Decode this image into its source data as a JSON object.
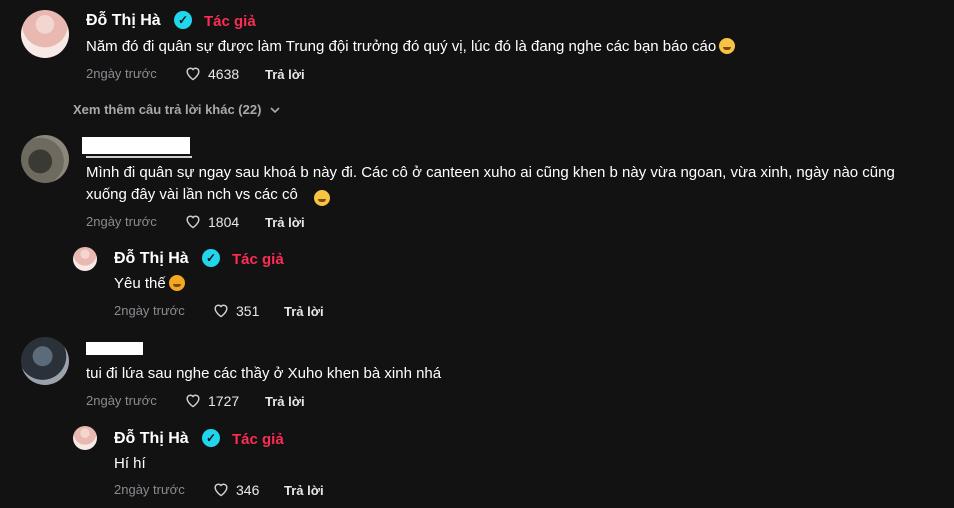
{
  "author": {
    "name": "Đỗ Thị Hà",
    "tag": "Tác giả",
    "verified_icon": "verified-check-icon",
    "badge_color": "#20d5ec",
    "tag_color": "#fe2c55"
  },
  "comments": [
    {
      "text": "Năm đó đi quân sự được làm Trung đội trưởng đó quý vị, lúc đó là đang nghe các bạn báo cáo",
      "time": "2ngày trước",
      "likes": "4638",
      "reply_label": "Trả lời",
      "more_replies": "Xem thêm câu trả lời khác (22)"
    },
    {
      "text": "Mình đi quân sự ngay sau khoá b này đi. Các cô ở canteen xuho ai cũng khen b này vừa ngoan, vừa xinh, ngày nào cũng xuống đây vài lần nch vs các cô",
      "time": "2ngày trước",
      "likes": "1804",
      "reply_label": "Trả lời",
      "reply": {
        "text": "Yêu thế",
        "time": "2ngày trước",
        "likes": "351",
        "reply_label": "Trả lời"
      }
    },
    {
      "text": "tui đi lứa sau nghe các thầy ở Xuho khen bà xinh nhá",
      "time": "2ngày trước",
      "likes": "1727",
      "reply_label": "Trả lời",
      "reply": {
        "text": "Hí hí",
        "time": "2ngày trước",
        "likes": "346",
        "reply_label": "Trả lời"
      }
    }
  ]
}
